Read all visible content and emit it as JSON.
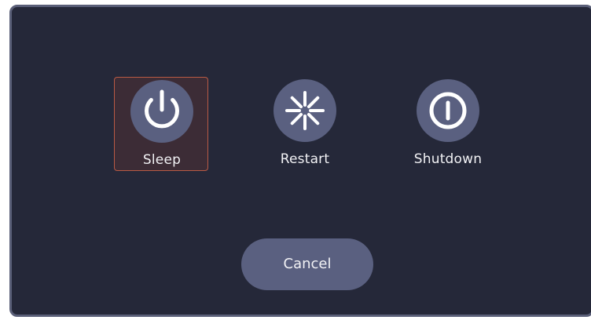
{
  "dialog": {
    "options": [
      {
        "label": "Sleep",
        "icon": "power-icon",
        "selected": true
      },
      {
        "label": "Restart",
        "icon": "restart-icon",
        "selected": false
      },
      {
        "label": "Shutdown",
        "icon": "shutdown-icon",
        "selected": false
      }
    ],
    "cancel_label": "Cancel"
  },
  "colors": {
    "background": "#252839",
    "border": "#5a5f78",
    "icon_circle": "#5a6080",
    "selected_fill": "#3c2c36",
    "selected_border": "#b95a45",
    "text": "#f2f2f5"
  }
}
